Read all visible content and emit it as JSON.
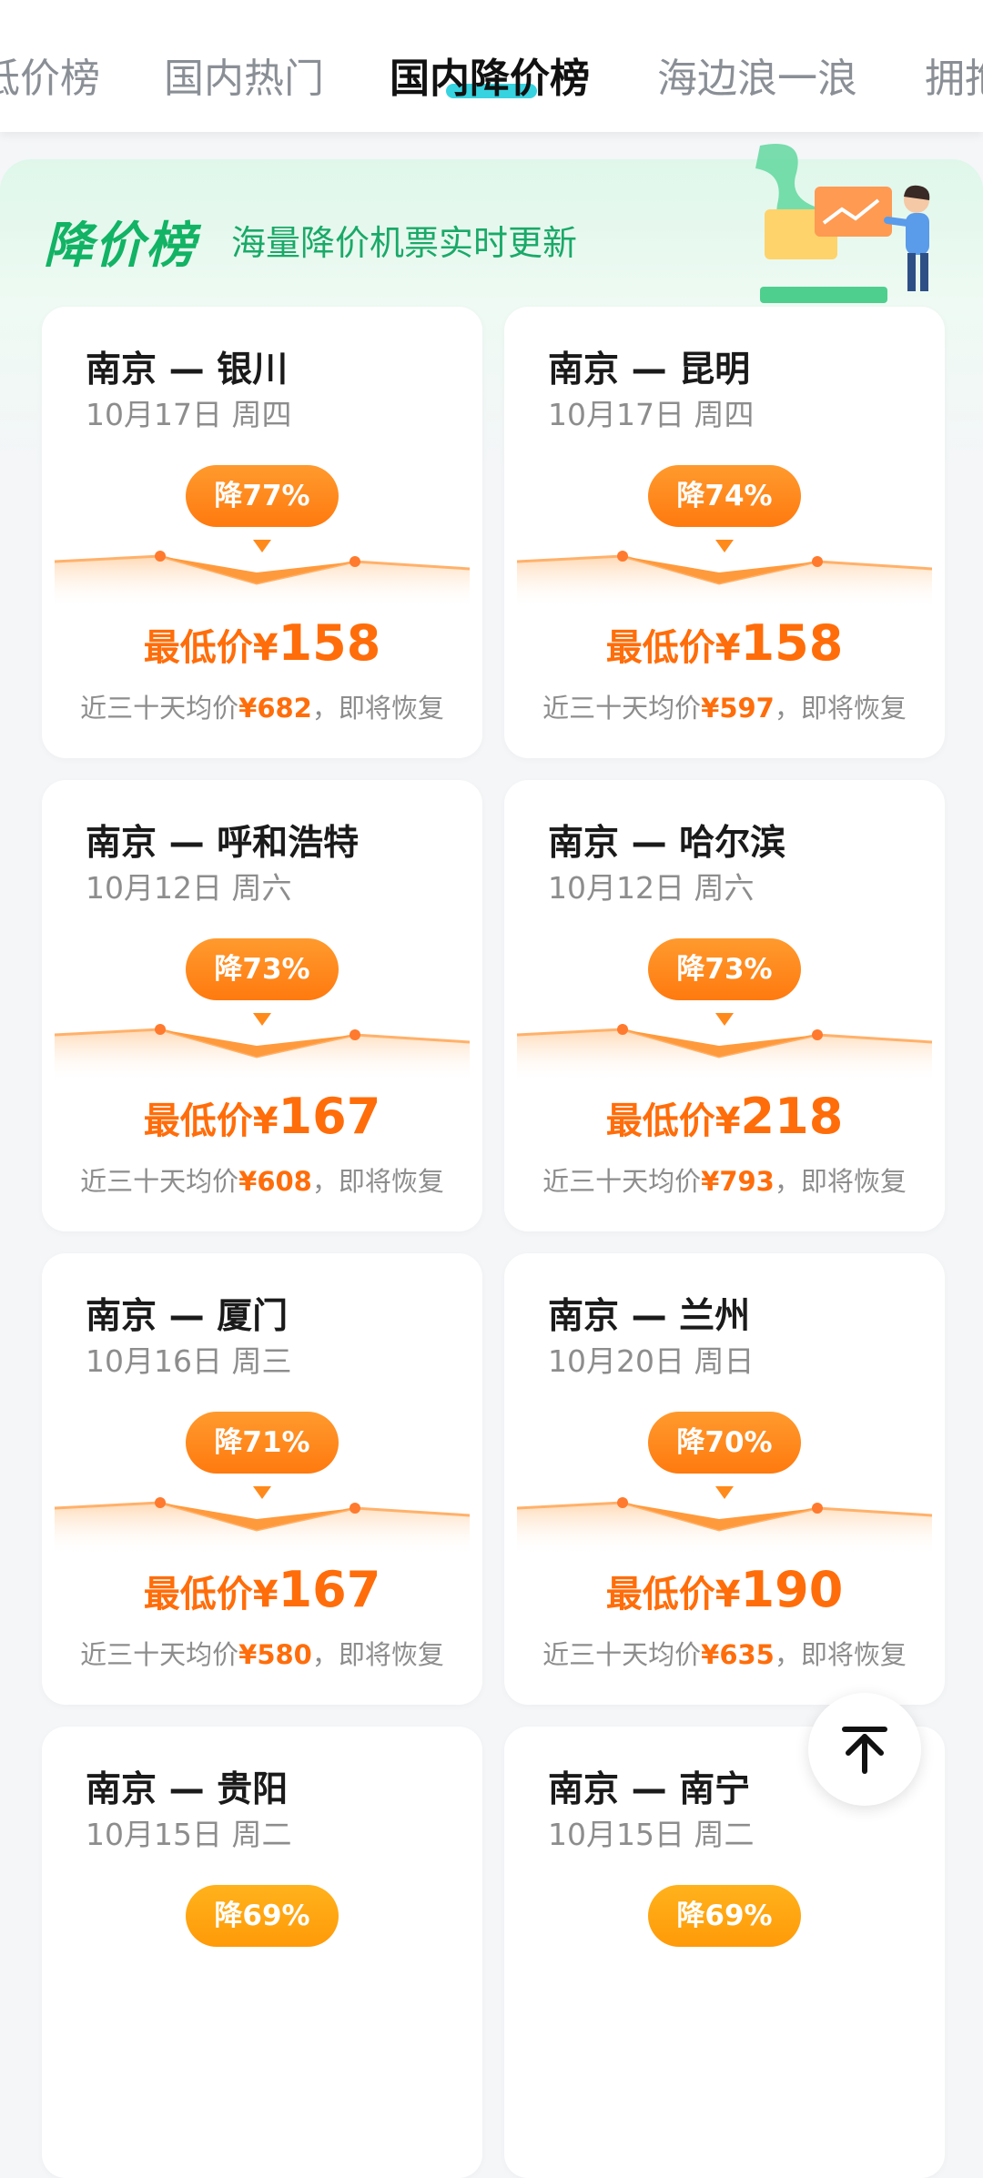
{
  "tabs": [
    {
      "label": "低价榜",
      "active": false
    },
    {
      "label": "国内热门",
      "active": false
    },
    {
      "label": "国内降价榜",
      "active": true
    },
    {
      "label": "海边浪一浪",
      "active": false
    },
    {
      "label": "拥抱",
      "active": false
    }
  ],
  "banner": {
    "title": "降价榜",
    "subtitle": "海量降价机票实时更新"
  },
  "cards": [
    {
      "route": "南京 — 银川",
      "date": "10月17日  周四",
      "badge": "降77%",
      "price_label": "最低价¥",
      "price": "158",
      "avg_prefix": "近三十天均价",
      "avg": "¥682",
      "avg_suffix": "，即将恢复"
    },
    {
      "route": "南京 — 昆明",
      "date": "10月17日  周四",
      "badge": "降74%",
      "price_label": "最低价¥",
      "price": "158",
      "avg_prefix": "近三十天均价",
      "avg": "¥597",
      "avg_suffix": "，即将恢复"
    },
    {
      "route": "南京 — 呼和浩特",
      "date": "10月12日  周六",
      "badge": "降73%",
      "price_label": "最低价¥",
      "price": "167",
      "avg_prefix": "近三十天均价",
      "avg": "¥608",
      "avg_suffix": "，即将恢复"
    },
    {
      "route": "南京 — 哈尔滨",
      "date": "10月12日  周六",
      "badge": "降73%",
      "price_label": "最低价¥",
      "price": "218",
      "avg_prefix": "近三十天均价",
      "avg": "¥793",
      "avg_suffix": "，即将恢复"
    },
    {
      "route": "南京 — 厦门",
      "date": "10月16日  周三",
      "badge": "降71%",
      "price_label": "最低价¥",
      "price": "167",
      "avg_prefix": "近三十天均价",
      "avg": "¥580",
      "avg_suffix": "，即将恢复"
    },
    {
      "route": "南京 — 兰州",
      "date": "10月20日  周日",
      "badge": "降70%",
      "price_label": "最低价¥",
      "price": "190",
      "avg_prefix": "近三十天均价",
      "avg": "¥635",
      "avg_suffix": "，即将恢复"
    },
    {
      "route": "南京 — 贵阳",
      "date": "10月15日  周二",
      "badge": "降69%"
    },
    {
      "route": "南京 — 南宁",
      "date": "10月15日  周二",
      "badge": "降69%"
    }
  ],
  "colors": {
    "accent": "#ff6d0a",
    "brand_green": "#12b364",
    "tab_indicator": "#37d3e0"
  },
  "icons": {
    "back_to_top": "arrow-up-to-line-icon"
  }
}
